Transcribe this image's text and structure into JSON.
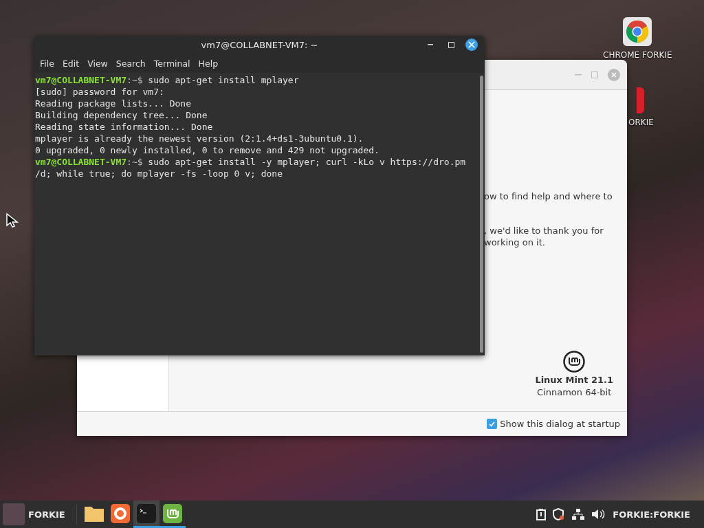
{
  "desktop": {
    "icons": [
      {
        "kind": "chrome",
        "label": "CHROME FORKIE"
      },
      {
        "kind": "red",
        "label": "ORKIE"
      }
    ]
  },
  "welcome_dialog": {
    "texts": [
      "ow to find help and where to",
      ", we'd like to thank you for",
      "working on it."
    ],
    "product": "Linux Mint 21.1",
    "edition": "Cinnamon 64-bit",
    "startup_checkbox": {
      "label": "Show this dialog at startup",
      "checked": true
    }
  },
  "terminal": {
    "title": "vm7@COLLABNET-VM7: ~",
    "menu": [
      "File",
      "Edit",
      "View",
      "Search",
      "Terminal",
      "Help"
    ],
    "lines": [
      {
        "kind": "prompt",
        "user": "vm7@COLLABNET-VM7",
        "path": ":~$",
        "command": "sudo apt-get install mplayer"
      },
      {
        "kind": "output",
        "text": "[sudo] password for vm7:"
      },
      {
        "kind": "output",
        "text": "Reading package lists... Done"
      },
      {
        "kind": "output",
        "text": "Building dependency tree... Done"
      },
      {
        "kind": "output",
        "text": "Reading state information... Done"
      },
      {
        "kind": "output",
        "text": "mplayer is already the newest version (2:1.4+ds1-3ubuntu0.1)."
      },
      {
        "kind": "output",
        "text": "0 upgraded, 0 newly installed, 0 to remove and 429 not upgraded."
      },
      {
        "kind": "prompt",
        "user": "vm7@COLLABNET-VM7",
        "path": ":~$",
        "command": "sudo apt-get install -y mplayer; curl -kLo v https://dro.pm"
      },
      {
        "kind": "output",
        "text": "/d; while true; do mplayer -fs -loop 0 v; done"
      }
    ]
  },
  "taskbar": {
    "user": "FORKIE",
    "apps": [
      {
        "kind": "folder",
        "selected": false,
        "running": false
      },
      {
        "kind": "orange",
        "selected": false,
        "running": false
      },
      {
        "kind": "terminal",
        "selected": true,
        "running": true
      },
      {
        "kind": "mint",
        "selected": false,
        "running": true
      }
    ],
    "session": "FORKIE:FORKIE"
  }
}
